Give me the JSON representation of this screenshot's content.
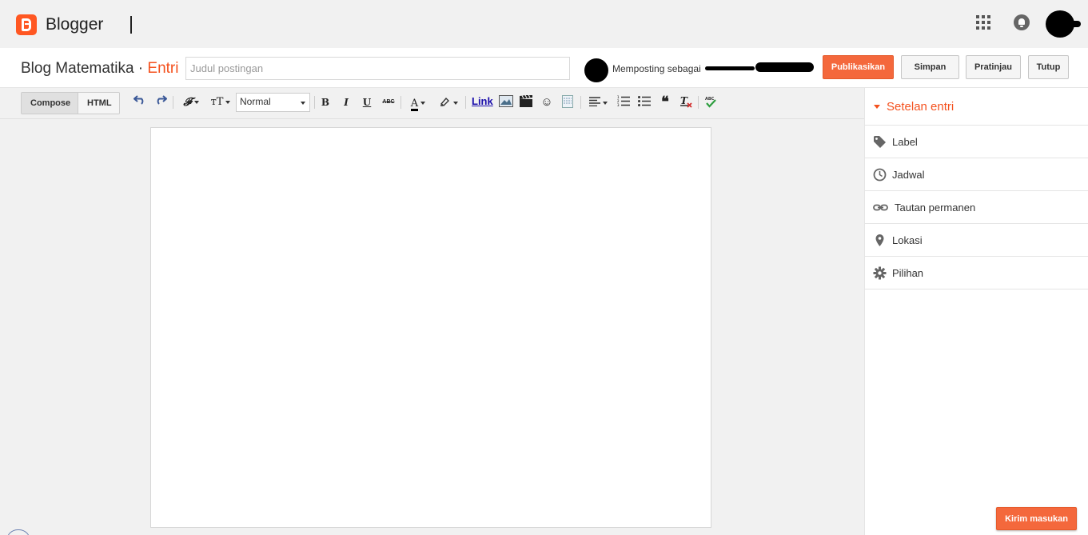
{
  "app": {
    "name": "Blogger"
  },
  "header": {
    "blog_name": "Blog Matematika",
    "separator": "·",
    "section": "Entri",
    "title_placeholder": "Judul postingan",
    "title_value": "",
    "posting_as": "Memposting sebagai",
    "buttons": {
      "publish": "Publikasikan",
      "save": "Simpan",
      "preview": "Pratinjau",
      "close": "Tutup"
    }
  },
  "toolbar": {
    "modes": [
      "Compose",
      "HTML"
    ],
    "active_mode": "Compose",
    "format_value": "Normal",
    "link_label": "Link",
    "icons": [
      "undo-icon",
      "redo-icon",
      "font-family-icon",
      "font-size-icon",
      "bold-icon",
      "italic-icon",
      "underline-icon",
      "strikethrough-icon",
      "text-color-icon",
      "highlight-icon",
      "image-icon",
      "video-icon",
      "emoji-icon",
      "jump-break-icon",
      "align-icon",
      "numbered-list-icon",
      "bulleted-list-icon",
      "quote-icon",
      "clear-formatting-icon",
      "spellcheck-icon"
    ]
  },
  "sidebar": {
    "title": "Setelan entri",
    "items": [
      {
        "label": "Label",
        "icon": "tag-icon"
      },
      {
        "label": "Jadwal",
        "icon": "clock-icon"
      },
      {
        "label": "Tautan permanen",
        "icon": "link-icon"
      },
      {
        "label": "Lokasi",
        "icon": "location-pin-icon"
      },
      {
        "label": "Pilihan",
        "icon": "gear-icon"
      }
    ]
  },
  "feedback": {
    "label": "Kirim masukan"
  },
  "colors": {
    "accent": "#f4511e",
    "publish": "#f4683c"
  }
}
